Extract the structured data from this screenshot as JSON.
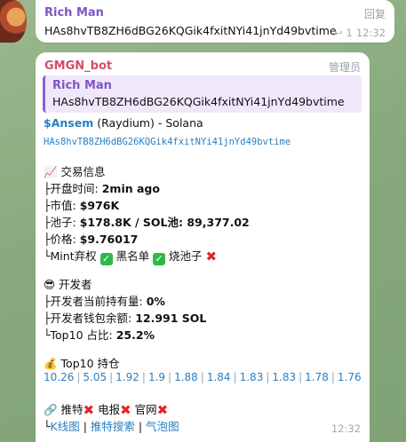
{
  "message1": {
    "sender": "Rich Man",
    "text": "HAs8hvTB8ZH6dBG26KQGik4fxitNYi41jnYd49bvtime",
    "reply_label": "回复",
    "reply_count": "1",
    "time": "12:32"
  },
  "message2": {
    "sender": "GMGN_bot",
    "badge": "管理员",
    "quote": {
      "sender": "Rich Man",
      "text": "HAs8hvTB8ZH6dBG26KQGik4fxitNYi41jnYd49bvtime"
    },
    "token_symbol": "$Ansem",
    "token_info": " (Raydium) - Solana",
    "contract": "HAs8hvTB8ZH6dBG26KQGik4fxitNYi41jnYd49bvtime",
    "trade_header": "📈 交易信息",
    "open_time_label": "├开盘时间: ",
    "open_time_value": "2min ago",
    "mcap_label": "├市值: ",
    "mcap_value": "$976K",
    "pool_label": "├池子: ",
    "pool_value": "$178.8K / SOL池: 89,377.02",
    "price_label": "├价格: ",
    "price_value": "$9.76017",
    "mint_label": "└Mint弃权 ",
    "blacklist_label": " 黑名单 ",
    "burn_label": " 烧池子 ",
    "dev_header": "😎 开发者",
    "dev_holding_label": "├开发者当前持有量: ",
    "dev_holding_value": "0%",
    "dev_balance_label": "├开发者钱包余额: ",
    "dev_balance_value": "12.991 SOL",
    "top10_label": "└Top10 占比: ",
    "top10_value": "25.2%",
    "holders_header": "💰 Top10 持仓",
    "holders": [
      "10.26",
      "5.05",
      "1.92",
      "1.9",
      "1.88",
      "1.84",
      "1.83",
      "1.83",
      "1.78",
      "1.76"
    ],
    "links_prefix": "🔗 推特",
    "telegram_label": " 电报",
    "website_label": " 官网",
    "links_line_prefix": "└",
    "kline_link": "K线图",
    "search_link": "推特搜索",
    "bubble_link": "气泡图",
    "time": "12:32"
  },
  "colors": {
    "accent_purple": "#7e55c7",
    "bot_name": "#d24e6c",
    "link_blue": "#2a7fc1",
    "check_green": "#2eb84c",
    "cross_red": "#e0262e"
  }
}
